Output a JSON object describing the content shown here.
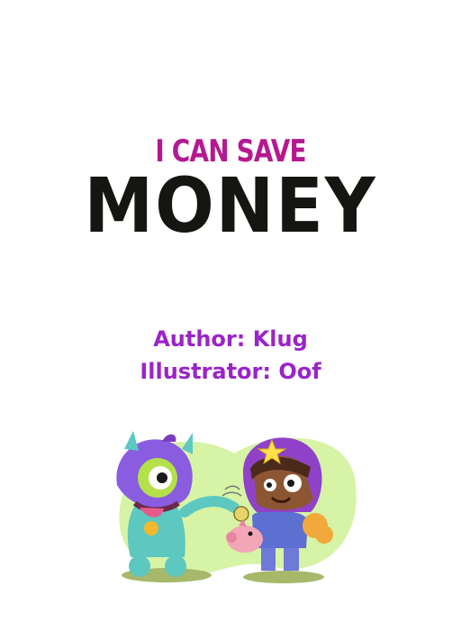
{
  "book": {
    "subtitle": "I CAN SAVE",
    "title": "MONEY",
    "author_line": "Author: Klug",
    "illustrator_line": "Illustrator: Oof"
  },
  "colors": {
    "subtitle": "#b5198f",
    "title": "#151612",
    "credits": "#9a24c9",
    "blob": "#d6f3a6",
    "monster": "#8a5ce0",
    "skin": "#8c5633",
    "helmet": "#8f42c7"
  },
  "illustration": {
    "characters": [
      "monster-icon",
      "child-icon",
      "piggy-bank-icon",
      "coin-icon"
    ]
  }
}
